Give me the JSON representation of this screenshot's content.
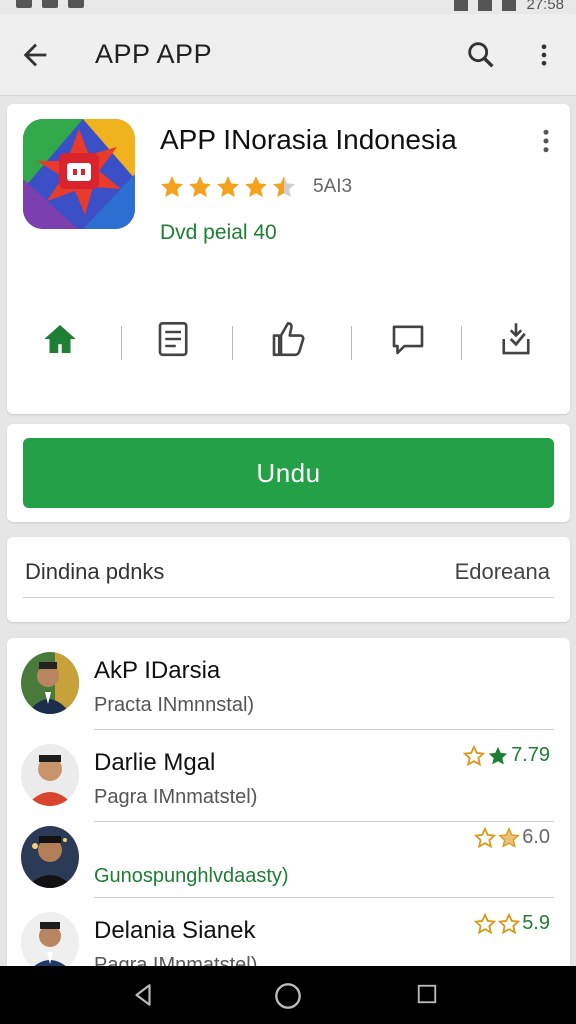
{
  "status_bar": {
    "time": "27:58"
  },
  "app_bar": {
    "title": "APP APP"
  },
  "app": {
    "name": "APP INorasia Indonesia",
    "rating_label": "5AI3",
    "star_count": 4.5,
    "developer": "Dvd peial 40",
    "actions": [
      "home-icon",
      "document-icon",
      "thumbs-up-icon",
      "chat-icon",
      "download-icon"
    ]
  },
  "install": {
    "label": "Undu"
  },
  "info": {
    "left": "Dindina pdnks",
    "right": "Edoreana"
  },
  "reviews": [
    {
      "name": "AkP IDarsia",
      "sub": "Practa INmnnstal)",
      "rating": ""
    },
    {
      "name": "Darlie Mgal",
      "sub": "Pagra IMnmatstel)",
      "rating": "7.79"
    },
    {
      "name": "",
      "sub": "Gunospunghlvdaasty)",
      "rating": "6.0"
    },
    {
      "name": "Delania Sianek",
      "sub": "Pagra IMnmatstel)",
      "rating": "5.9"
    }
  ],
  "colors": {
    "accent_green": "#24a047",
    "text_green": "#1e7e34",
    "star_orange": "#f4a21d"
  }
}
